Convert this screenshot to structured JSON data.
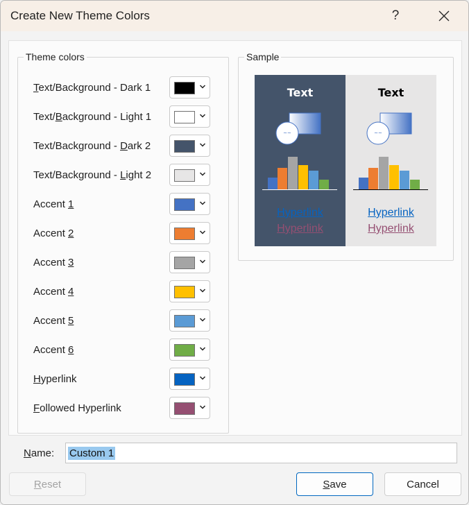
{
  "dialog": {
    "title": "Create New Theme Colors",
    "help_label": "?",
    "close_label": "✕"
  },
  "theme_colors": {
    "legend": "Theme colors",
    "items": [
      {
        "pre": "",
        "key": "T",
        "post": "ext/Background - Dark 1",
        "color": "#000000"
      },
      {
        "pre": "Text/",
        "key": "B",
        "post": "ackground - Light 1",
        "color": "#ffffff"
      },
      {
        "pre": "Text/Background - ",
        "key": "D",
        "post": "ark 2",
        "color": "#44546a"
      },
      {
        "pre": "Text/Background - ",
        "key": "L",
        "post": "ight 2",
        "color": "#e7e6e6"
      },
      {
        "pre": "Accent ",
        "key": "1",
        "post": "",
        "color": "#4472c4"
      },
      {
        "pre": "Accent ",
        "key": "2",
        "post": "",
        "color": "#ed7d31"
      },
      {
        "pre": "Accent ",
        "key": "3",
        "post": "",
        "color": "#a5a5a5"
      },
      {
        "pre": "Accent ",
        "key": "4",
        "post": "",
        "color": "#ffc000"
      },
      {
        "pre": "Accent ",
        "key": "5",
        "post": "",
        "color": "#5b9bd5"
      },
      {
        "pre": "Accent ",
        "key": "6",
        "post": "",
        "color": "#70ad47"
      },
      {
        "pre": "",
        "key": "H",
        "post": "yperlink",
        "color": "#0563c1"
      },
      {
        "pre": "",
        "key": "F",
        "post": "ollowed Hyperlink",
        "color": "#954f72"
      }
    ]
  },
  "sample": {
    "legend": "Sample",
    "text_label": "Text",
    "hyperlink_label": "Hyperlink",
    "followed_hyperlink_label": "Hyperlink",
    "dark_text_color": "#ffffff",
    "light_text_color": "#000000"
  },
  "name": {
    "pre": "",
    "key": "N",
    "post": "ame:",
    "value": "Custom 1"
  },
  "buttons": {
    "reset": {
      "key": "R",
      "post": "eset"
    },
    "save": {
      "key": "S",
      "post": "ave"
    },
    "cancel": "Cancel"
  }
}
